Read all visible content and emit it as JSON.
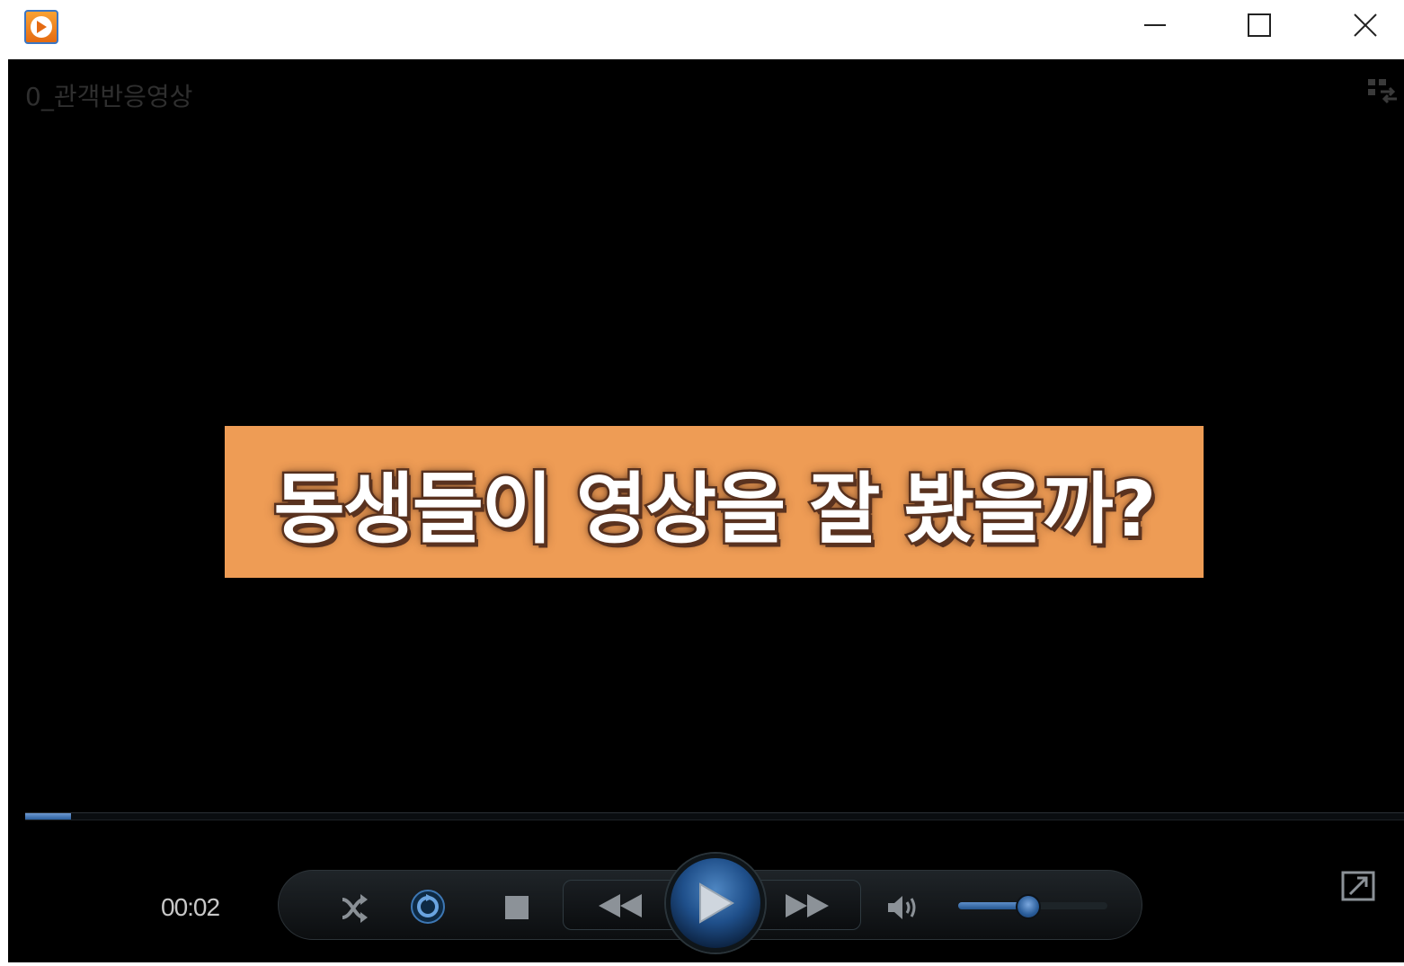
{
  "window": {
    "app_icon": "media-player-icon",
    "controls": {
      "minimize_icon": "minimize-icon",
      "maximize_icon": "maximize-icon",
      "close_icon": "close-icon"
    }
  },
  "player": {
    "media_title": "0_관객반응영상",
    "view_switch_icon": "switch-to-library-icon",
    "caption": "동생들이 영상을 잘 봤을까?",
    "caption_bg_color": "#ee9c55",
    "seek": {
      "progress_percent": 3.3
    },
    "time": "00:02",
    "controls": {
      "shuffle_icon": "shuffle-icon",
      "repeat_icon": "repeat-icon",
      "stop_icon": "stop-icon",
      "previous_icon": "previous-icon",
      "play_icon": "play-icon",
      "next_icon": "next-icon",
      "mute_icon": "volume-icon",
      "volume_percent": 47,
      "now_playing_icon": "switch-to-now-playing-icon"
    },
    "accent_color": "#2b5f9e"
  }
}
